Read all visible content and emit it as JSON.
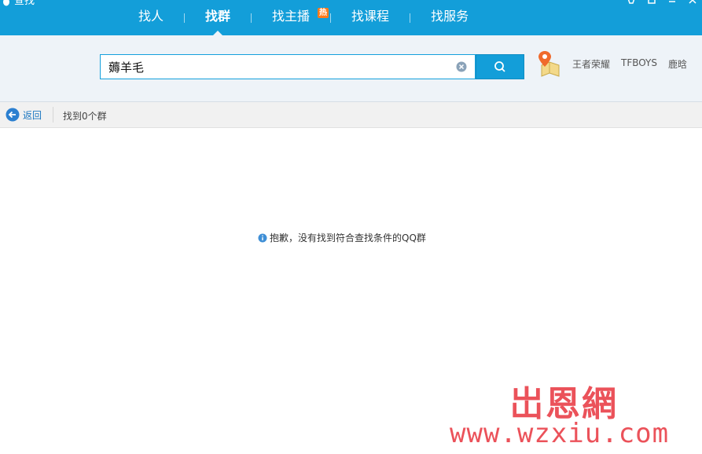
{
  "window": {
    "title": "查找"
  },
  "tabs": [
    {
      "label": "找人",
      "active": false
    },
    {
      "label": "找群",
      "active": true
    },
    {
      "label": "找主播",
      "active": false,
      "badge": "热"
    },
    {
      "label": "找课程",
      "active": false
    },
    {
      "label": "找服务",
      "active": false
    }
  ],
  "search": {
    "value": "薅羊毛",
    "placeholder": ""
  },
  "hot_tags": [
    "王者荣耀",
    "TFBOYS",
    "鹿晗"
  ],
  "subbar": {
    "back_label": "返回",
    "result_count": "找到0个群"
  },
  "results": {
    "empty_message": "抱歉，没有找到符合查找条件的QQ群"
  },
  "watermark": {
    "logo_text": "岀恩網",
    "url": "www.wzxiu.com"
  },
  "colors": {
    "brand": "#139ed9",
    "link": "#1d78c1",
    "badge": "#ff7a1a",
    "watermark": "#e8343e"
  }
}
